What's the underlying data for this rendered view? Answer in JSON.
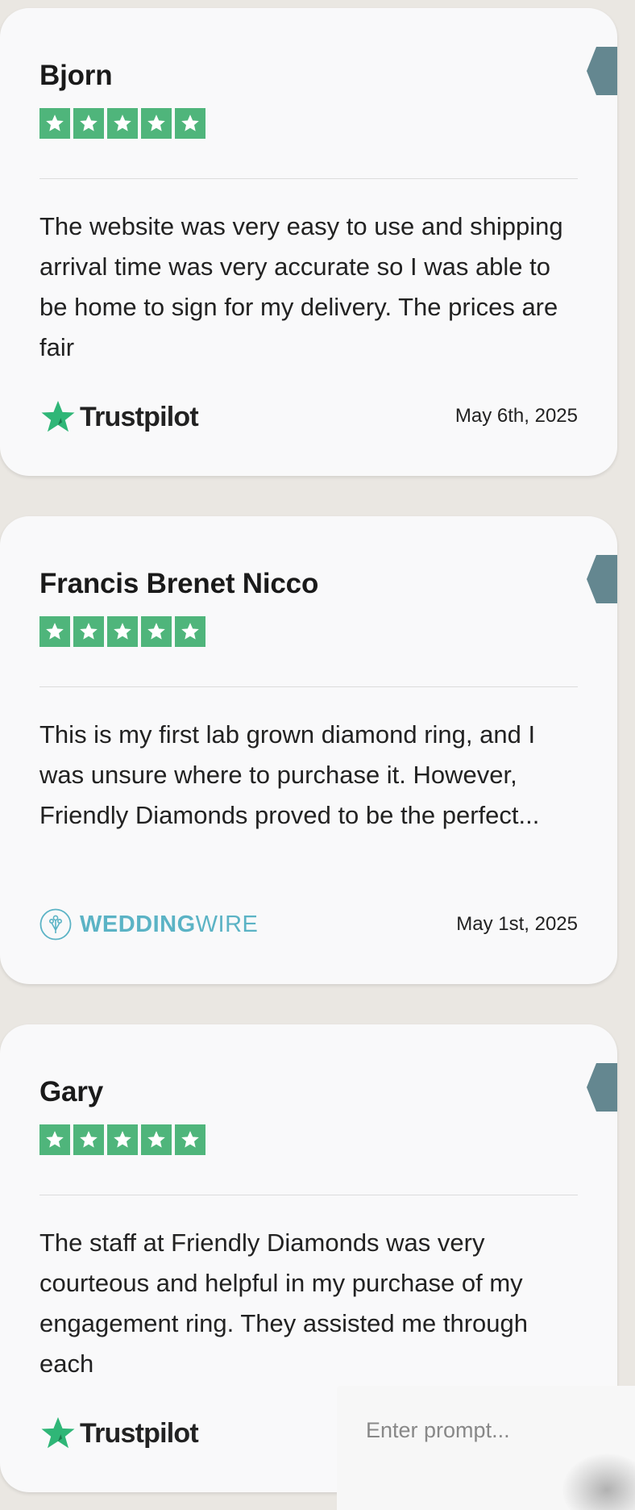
{
  "reviews": [
    {
      "name": "Bjorn",
      "rating": 5,
      "text": "The website was very easy to use and shipping arrival time was very accurate so I was able to be home to sign for my delivery. The prices are fair",
      "source": "Trustpilot",
      "date": "May 6th, 2025"
    },
    {
      "name": "Francis Brenet Nicco",
      "rating": 5,
      "text": "This is my first lab grown diamond ring, and I was unsure where to purchase it. However, Friendly Diamonds proved to be the perfect...",
      "source_bold": "WEDDING",
      "source_light": "WIRE",
      "date": "May 1st, 2025"
    },
    {
      "name": "Gary",
      "rating": 5,
      "text": "The staff at Friendly Diamonds was very courteous and helpful in my purchase of my engagement ring. They assisted me through each",
      "source": "Trustpilot"
    }
  ],
  "prompt": {
    "placeholder": "Enter prompt..."
  },
  "colors": {
    "star_green": "#4fb57b",
    "trustpilot_star": "#2fb677",
    "weddingwire_teal": "#5bb3c5",
    "side_tab": "#648790",
    "card_bg": "#f9f9fa",
    "page_bg": "#eae7e2"
  },
  "icons": [
    "star-icon",
    "trustpilot-star-icon",
    "weddingwire-logo-icon"
  ]
}
